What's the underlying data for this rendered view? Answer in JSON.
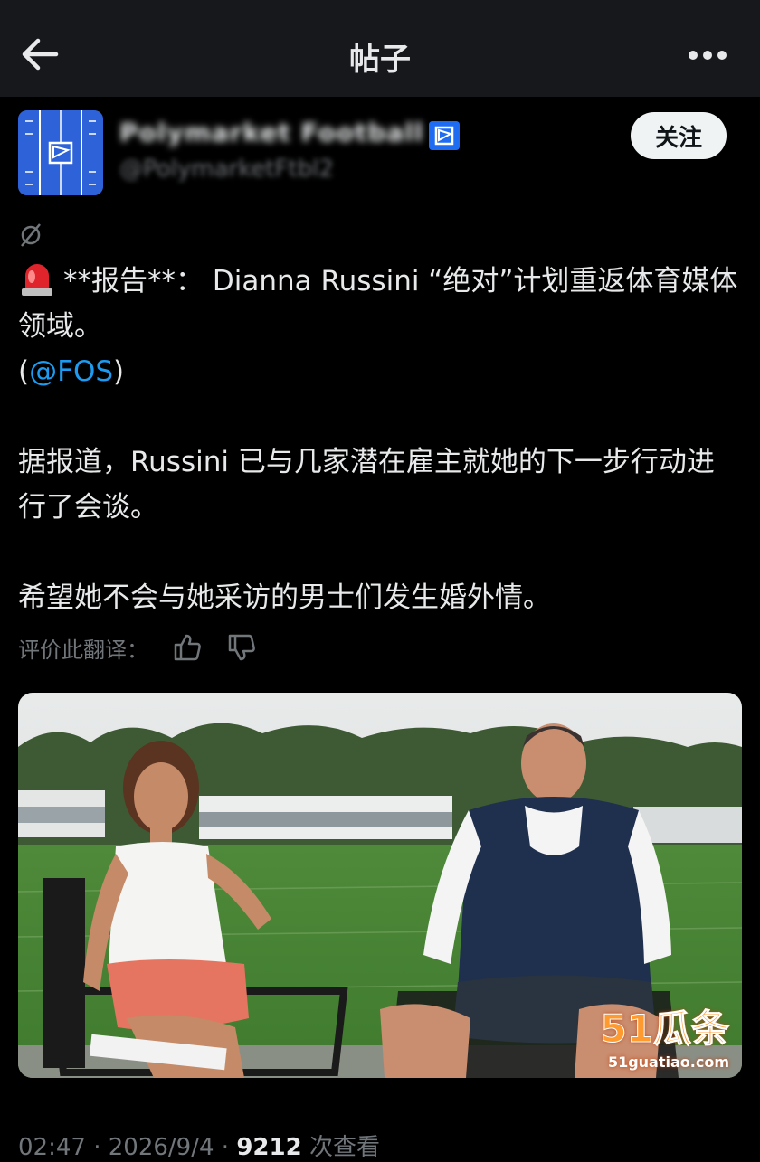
{
  "header": {
    "title": "帖子"
  },
  "author": {
    "name": "Polymarket Football",
    "handle": "@PolymarketFtbl2",
    "follow_label": "关注"
  },
  "post": {
    "line1": "**报告**： Dianna Russini “绝对”计划重返体育媒体领域。",
    "mention_open": "(",
    "mention": "@FOS",
    "mention_close": ")",
    "paragraph2": "据报道，Russini 已与几家潜在雇主就她的下一步行动进行了会谈。",
    "paragraph3": "希望她不会与她采访的男士们发生婚外情。"
  },
  "translation": {
    "rate_label": "评价此翻译："
  },
  "watermark": {
    "main": "51瓜条",
    "sub": "51guatiao.com"
  },
  "meta": {
    "time": "02:47",
    "sep1": " · ",
    "date": "2026/9/4",
    "sep2": " · ",
    "views": "9212",
    "views_label": " 次查看"
  },
  "colors": {
    "background": "#000000",
    "link": "#1d9bf0",
    "muted": "#71767b",
    "text": "#e7e9ea"
  },
  "icons": [
    "back-arrow-icon",
    "more-icon",
    "translate-icon",
    "siren-icon",
    "thumbs-up-icon",
    "thumbs-down-icon",
    "verified-badge-icon"
  ]
}
